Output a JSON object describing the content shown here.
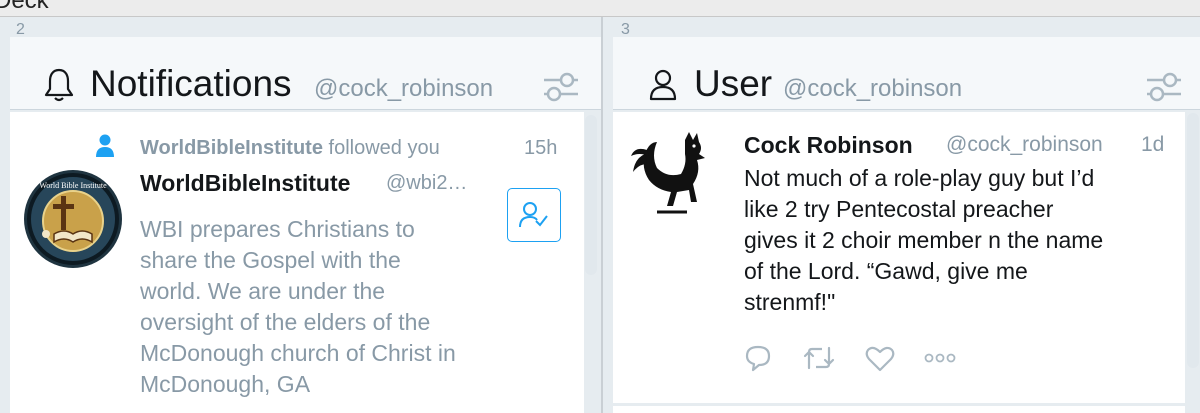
{
  "app": {
    "title": "Deck"
  },
  "notifications_column": {
    "number": "2",
    "title": "Notifications",
    "handle": "@cock_robinson",
    "notification": {
      "actor": "WorldBibleInstitute",
      "action": " followed you",
      "time": "15h",
      "profile_name": "WorldBibleInstitute",
      "profile_handle": "@wbi2…",
      "bio_lines": [
        "WBI prepares Christians to",
        "share the Gospel with the",
        "world. We are under the",
        "oversight of the elders of the",
        "McDonough church of Christ in",
        "McDonough, GA"
      ],
      "avatar_label": "World Bible Institute"
    }
  },
  "user_column": {
    "number": "3",
    "title": "User",
    "handle": "@cock_robinson",
    "tweet": {
      "name": "Cock Robinson",
      "handle": "@cock_robinson",
      "time": "1d",
      "lines": [
        "Not much of a role-play guy but I’d",
        "like 2 try Pentecostal preacher",
        "gives it 2 choir member n the name",
        "of the Lord. “Gawd, give me",
        "strenmf!\""
      ]
    }
  },
  "colors": {
    "accent": "#1da1f2",
    "muted": "#8899a6",
    "text": "#14171a"
  }
}
